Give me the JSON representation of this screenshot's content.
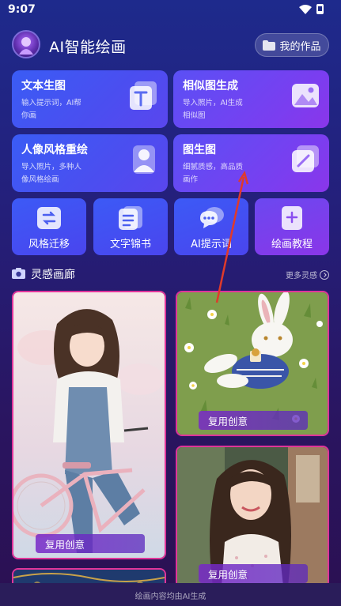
{
  "status_bar": {
    "time": "9:07"
  },
  "header": {
    "app_title": "AI智能绘画",
    "my_works_label": "我的作品"
  },
  "feature_cards": [
    {
      "title": "文本生图",
      "desc": "输入提示词，AI帮你画",
      "icon": "text-t-icon"
    },
    {
      "title": "相似图生成",
      "desc": "导入照片，AI生成相似图",
      "icon": "image-landscape-icon"
    },
    {
      "title": "人像风格重绘",
      "desc": "导入照片，多种人像风格绘画",
      "icon": "portrait-person-icon"
    },
    {
      "title": "图生图",
      "desc": "细腻质感，高品质画作",
      "icon": "image-edit-icon"
    }
  ],
  "tools": [
    {
      "label": "风格迁移",
      "icon": "style-transfer-icon"
    },
    {
      "label": "文字锦书",
      "icon": "text-document-icon"
    },
    {
      "label": "AI提示词",
      "icon": "chat-bubble-icon"
    },
    {
      "label": "绘画教程",
      "icon": "tutorial-book-icon"
    }
  ],
  "gallery": {
    "title": "灵感画廊",
    "more_label": "更多灵感",
    "items": [
      {
        "reuse_label": "复用创意",
        "subject": "girl-with-bicycle"
      },
      {
        "reuse_label": "复用创意",
        "subject": "bunny-in-grass"
      },
      {
        "reuse_label": "复用创意",
        "subject": "smiling-woman"
      },
      {
        "subject": "ornate-blue-pattern"
      }
    ]
  },
  "footer": {
    "note": "绘画内容均由AI生成"
  },
  "colors": {
    "accent_blue": "#3c5af6",
    "accent_purple": "#8a36e8",
    "card_border": "#e0359a",
    "annotation_arrow": "#e03a2a"
  }
}
